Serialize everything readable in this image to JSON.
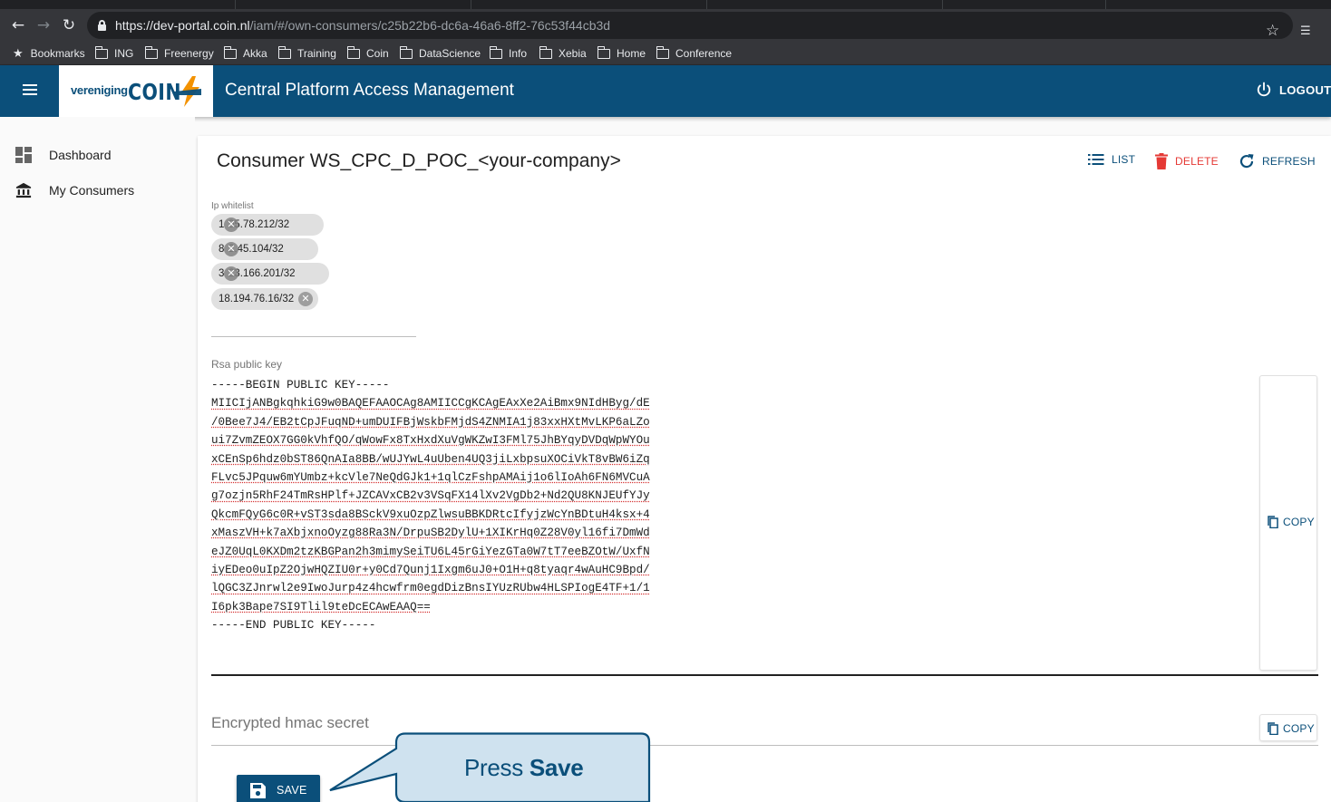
{
  "browser": {
    "url_host": "https://dev-portal.coin.nl",
    "url_path": "/iam/#/own-consumers/c25b22b6-dc6a-46a6-8ff2-76c53f44cb3d",
    "bookmarks": [
      "Bookmarks",
      "ING",
      "Freenergy",
      "Akka",
      "Training",
      "Coin",
      "DataScience",
      "Info",
      "Xebia",
      "Home",
      "Conference"
    ]
  },
  "header": {
    "logo_prefix": "vereniging",
    "logo_main": "COIN",
    "title": "Central Platform Access Management",
    "logout_label": "LOGOUT"
  },
  "sidebar": {
    "items": [
      {
        "label": "Dashboard",
        "icon": "dashboard-icon"
      },
      {
        "label": "My Consumers",
        "icon": "bank-icon"
      }
    ]
  },
  "main": {
    "title": "Consumer WS_CPC_D_POC_<your-company>",
    "toolbar": {
      "list_label": "LIST",
      "delete_label": "DELETE",
      "refresh_label": "REFRESH"
    },
    "ip_whitelist": {
      "label": "Ip whitelist",
      "chips": [
        "1  95.78.212/32",
        "8  2.45.104/32",
        "3  23.166.201/32",
        "18.194.76.16/32"
      ]
    },
    "rsa": {
      "label": "Rsa public key",
      "lines": [
        "-----BEGIN PUBLIC KEY-----",
        "MIICIjANBgkqhkiG9w0BAQEFAAOCAg8AMIICCgKCAgEAxXe2AiBmx9NIdHByg/dE",
        "/0Bee7J4/EB2tCpJFuqND+umDUIFBjWskbFMjdS4ZNMIA1j83xxHXtMvLKP6aLZo",
        "ui7ZvmZEOX7GG0kVhfQO/qWowFx8TxHxdXuVgWKZwI3FMl75JhBYqyDVDqWpWYOu",
        "xCEnSp6hdz0bST86QnAIa8BB/wUJYwL4uUben4UQ3jiLxbpsuXOCiVkT8vBW6iZq",
        "FLvc5JPquw6mYUmbz+kcVle7NeQdGJk1+1qlCzFshpAMAij1o6lIoAh6FN6MVCuA",
        "g7ozjn5RhF24TmRsHPlf+JZCAVxCB2v3VSqFX14lXv2VgDb2+Nd2QU8KNJEUfYJy",
        "QkcmFQyG6c0R+vST3sda8BSckV9xuOzpZlwsuBBKDRtcIfyjzWcYnBDtuH4ksx+4",
        "xMaszVH+k7aXbjxnoOyzg88Ra3N/DrpuSB2DylU+1XIKrHq0Z28V0yl16fi7DmWd",
        "eJZ0UqL0KXDm2tzKBGPan2h3mimySeiTU6L45rGiYezGTa0W7tT7eeBZOtW/UxfN",
        "iyEDeo0uIpZ2OjwHQZIU0r+y0Cd7Qunj1Ixgm6uJ0+O1H+q8tyaqr4wAuHC9Bpd/",
        "lQGC3ZJnrwl2e9IwoJurp4z4hcwfrm0egdDizBnsIYUzRUbw4HLSPIogE4TF+1/1",
        "I6pk3Bape7SI9Tlil9teDcECAwEAAQ==",
        "-----END PUBLIC KEY-----"
      ],
      "copy_label": "COPY"
    },
    "hmac": {
      "label": "Encrypted hmac secret",
      "copy_label": "COPY"
    },
    "save_label": "SAVE"
  },
  "callout": {
    "prefix": "Press ",
    "emphasis": "Save"
  },
  "colors": {
    "primary": "#0b4f7a",
    "danger": "#e53935",
    "accent_logo": "#f39200",
    "callout_fill": "#cfe2ef"
  }
}
